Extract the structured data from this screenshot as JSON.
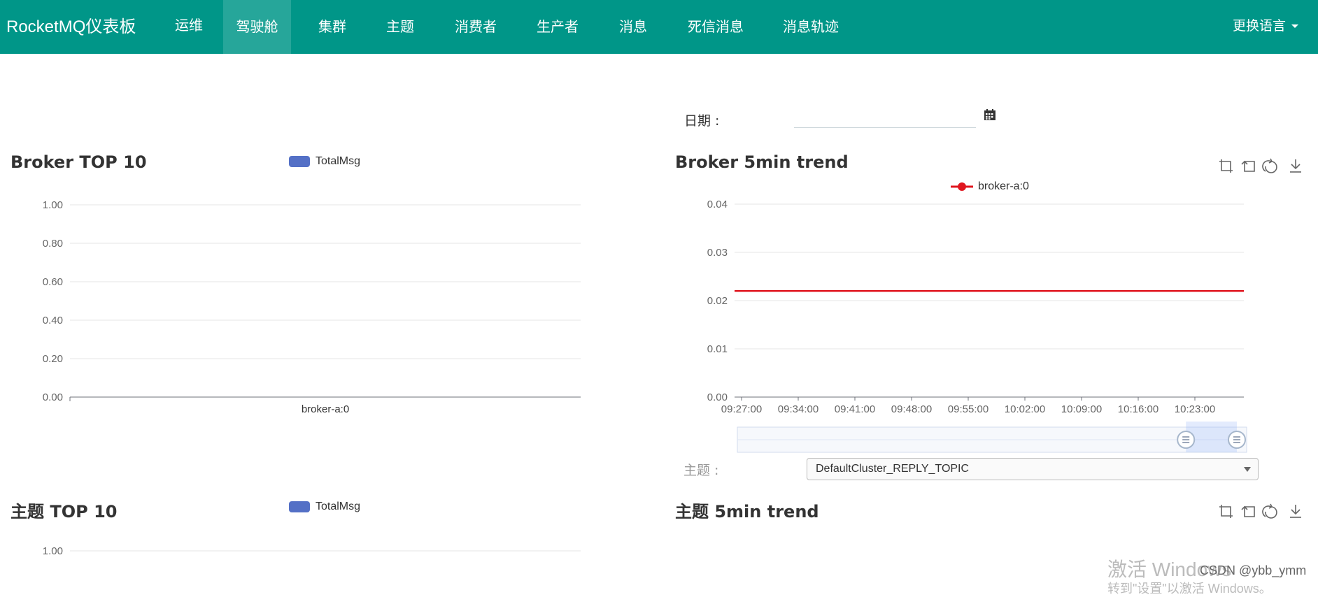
{
  "navbar": {
    "brand": "RocketMQ仪表板",
    "items": [
      {
        "label": "运维"
      },
      {
        "label": "驾驶舱"
      },
      {
        "label": "集群"
      },
      {
        "label": "主题"
      },
      {
        "label": "消费者"
      },
      {
        "label": "生产者"
      },
      {
        "label": "消息"
      },
      {
        "label": "死信消息"
      },
      {
        "label": "消息轨迹"
      }
    ],
    "active_item": "驾驶舱",
    "language_label": "更换语言"
  },
  "date_filter": {
    "label": "日期 :",
    "value": ""
  },
  "broker_top10": {
    "title": "Broker TOP 10",
    "legend": "TotalMsg",
    "color": "#5470c6",
    "chart_data": {
      "type": "bar",
      "categories": [
        "broker-a:0"
      ],
      "series": [
        {
          "name": "TotalMsg",
          "values": [
            0
          ]
        }
      ],
      "y_ticks": [
        "1.00",
        "0.80",
        "0.60",
        "0.40",
        "0.20",
        "0.00"
      ],
      "ylim": [
        0,
        1
      ]
    }
  },
  "broker_trend": {
    "title": "Broker 5min trend",
    "legend": "broker-a:0",
    "color": "#e0161f",
    "chart_data": {
      "type": "line",
      "x_ticks": [
        "09:27:00",
        "09:34:00",
        "09:41:00",
        "09:48:00",
        "09:55:00",
        "10:02:00",
        "10:09:00",
        "10:16:00",
        "10:23:00"
      ],
      "y_ticks": [
        "0.04",
        "0.03",
        "0.02",
        "0.01",
        "0.00"
      ],
      "ylim": [
        0,
        0.04
      ],
      "series": [
        {
          "name": "broker-a:0",
          "values": [
            0.022,
            0.022,
            0.022,
            0.022,
            0.022,
            0.022,
            0.022,
            0.022,
            0.022,
            0.022
          ]
        }
      ]
    },
    "zoom_range": [
      0.9,
      1.0
    ]
  },
  "topic_filter": {
    "label": "主题 :",
    "selected": "DefaultCluster_REPLY_TOPIC"
  },
  "topic_top10": {
    "title": "主题 TOP 10",
    "legend": "TotalMsg",
    "y_ticks": [
      "1.00"
    ]
  },
  "topic_trend": {
    "title": "主题 5min trend"
  },
  "watermark": {
    "line1": "激活 Windows",
    "line2": "转到\"设置\"以激活 Windows。",
    "csdn": "CSDN @ybb_ymm"
  }
}
